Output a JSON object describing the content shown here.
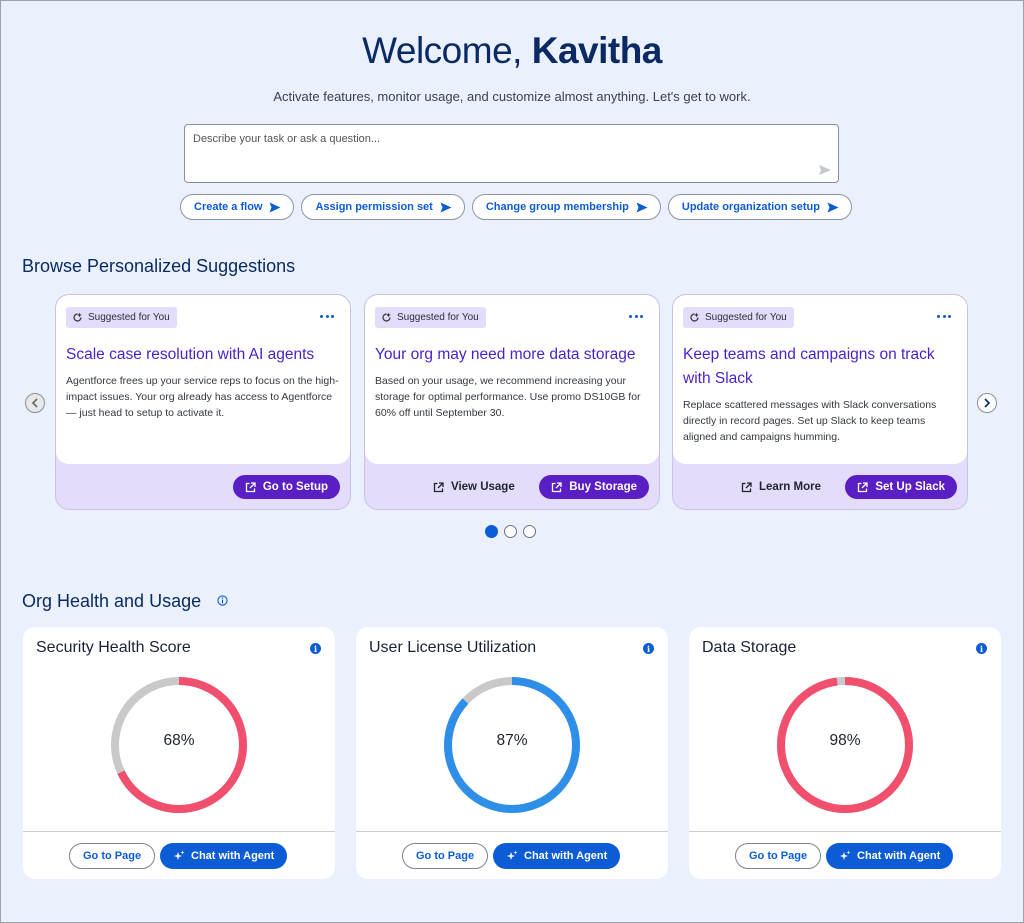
{
  "header": {
    "greeting": "Welcome,",
    "user_name": "Kavitha",
    "subtitle": "Activate features, monitor usage, and customize almost anything. Let's get to work."
  },
  "ask": {
    "placeholder": "Describe your task or ask a question...",
    "value": ""
  },
  "quick_actions": [
    {
      "label": "Create a flow"
    },
    {
      "label": "Assign permission set"
    },
    {
      "label": "Change group membership"
    },
    {
      "label": "Update organization setup"
    }
  ],
  "suggestions": {
    "title": "Browse Personalized Suggestions",
    "cards": [
      {
        "badge": "Suggested for You",
        "title": "Scale case resolution with AI agents",
        "description": "Agentforce frees up your service reps to focus on the high-impact issues. Your org already has access to Agentforce — just head to setup to activate it.",
        "primary": "Go to Setup",
        "secondary": ""
      },
      {
        "badge": "Suggested for You",
        "title": "Your org may need more data storage",
        "description": "Based on your usage, we recommend increasing your storage for optimal performance. Use promo DS10GB for 60% off until September 30.",
        "primary": "Buy Storage",
        "secondary": "View Usage"
      },
      {
        "badge": "Suggested for You",
        "title": "Keep teams and campaigns on track with Slack",
        "description": "Replace scattered messages with Slack conversations directly in record pages. Set up Slack to keep teams aligned and campaigns humming.",
        "primary": "Set Up Slack",
        "secondary": "Learn More"
      }
    ],
    "pages": 3,
    "active_page": 1
  },
  "health": {
    "title": "Org Health and Usage",
    "metrics": [
      {
        "title": "Security Health Score",
        "value_label": "68%",
        "value": 68,
        "color": "#f0506e",
        "track": "#c9c9c9",
        "go": "Go to Page",
        "chat": "Chat with Agent"
      },
      {
        "title": "User License Utilization",
        "value_label": "87%",
        "value": 87,
        "color": "#2e8fe8",
        "track": "#c9c9c9",
        "go": "Go to Page",
        "chat": "Chat with Agent"
      },
      {
        "title": "Data Storage",
        "value_label": "98%",
        "value": 98,
        "color": "#f0506e",
        "track": "#c9c9c9",
        "go": "Go to Page",
        "chat": "Chat with Agent"
      }
    ]
  },
  "colors": {
    "accent": "#0b5cd5",
    "brand_purple": "#5a1ec5",
    "background": "#eaf1fc"
  },
  "icons": {
    "send": "send-icon",
    "external": "external-link-icon",
    "sparkle": "sparkle-icon",
    "suggested": "refresh-sparkle-icon"
  }
}
